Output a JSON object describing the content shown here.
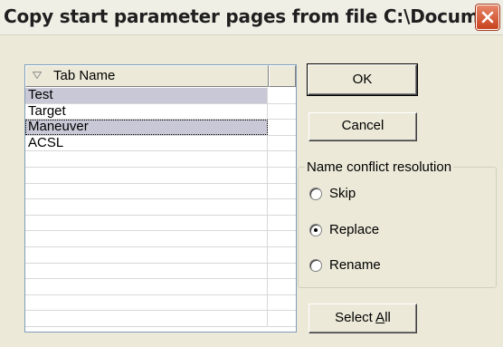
{
  "window": {
    "title": "Copy start parameter pages from file C:\\Docum..."
  },
  "list": {
    "header": "Tab Name",
    "rows": [
      "Test",
      "Target",
      "Maneuver",
      "ACSL",
      "",
      "",
      "",
      "",
      "",
      "",
      "",
      "",
      "",
      "",
      ""
    ]
  },
  "buttons": {
    "ok": "OK",
    "cancel": "Cancel",
    "select_all_prefix": "Select ",
    "select_all_mnemonic": "A",
    "select_all_suffix": "ll"
  },
  "conflict": {
    "label": "Name conflict resolution",
    "options": [
      "Skip",
      "Replace",
      "Rename"
    ],
    "selected": "Replace"
  }
}
